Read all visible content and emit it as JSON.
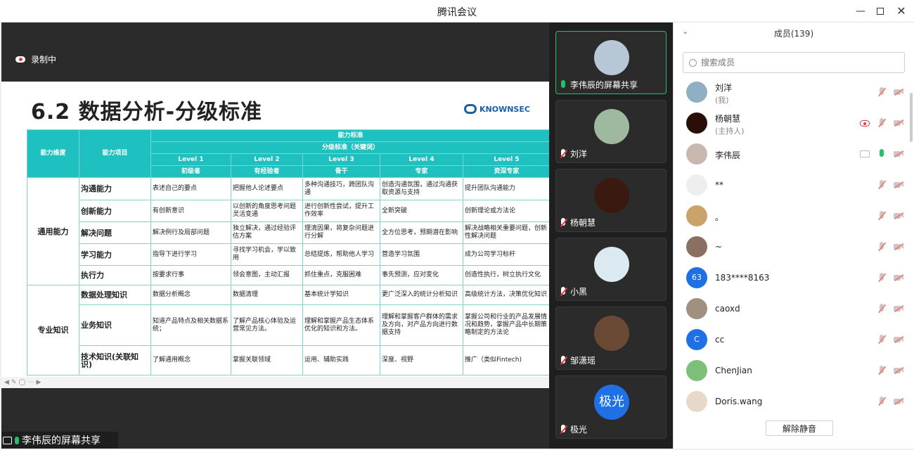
{
  "window": {
    "title": "腾讯会议"
  },
  "recording": {
    "label": "录制中"
  },
  "slide": {
    "title": "6.2 数据分析-分级标准",
    "brand": "KNOWNSEC",
    "header": {
      "dimension": "能力维度",
      "item": "能力项目",
      "standard": "能力标准",
      "grading": "分级标准（关键词）",
      "levels": [
        "Level 1",
        "Level 2",
        "Level 3",
        "Level 4",
        "Level 5"
      ],
      "titles": [
        "初级者",
        "有经验者",
        "骨干",
        "专家",
        "资深专家"
      ]
    },
    "groups": [
      {
        "dimension": "通用能力",
        "rows": [
          {
            "item": "沟通能力",
            "cells": [
              "表述自己的要点",
              "把握他人论述要点",
              "多种沟通技巧，跨团队沟通",
              "创造沟通氛围，通过沟通获取资源与支持",
              "提升团队沟通能力"
            ]
          },
          {
            "item": "创新能力",
            "cells": [
              "有创新意识",
              "以创新的角度思考问题灵活变通",
              "进行创新性尝试，提升工作效率",
              "全新突破",
              "创新理论或方法论"
            ]
          },
          {
            "item": "解决问题",
            "cells": [
              "解决例行及局部问题",
              "独立解决，通过经验评估方案",
              "理清因果，将复杂问题进行分解",
              "全方位思考，预期潜在影响",
              "解决战略相关重要问题，创新性解决问题"
            ]
          },
          {
            "item": "学习能力",
            "cells": [
              "指导下进行学习",
              "寻找学习机会，学以致用",
              "总结提炼，帮助他人学习",
              "营造学习氛围",
              "成为公司学习标杆"
            ]
          },
          {
            "item": "执行力",
            "cells": [
              "按要求行事",
              "领会意图，主动汇报",
              "抓住重点，克服困难",
              "事先预测，应对变化",
              "创造性执行，树立执行文化"
            ]
          }
        ]
      },
      {
        "dimension": "专业知识",
        "rows": [
          {
            "item": "数据处理知识",
            "cells": [
              "数据分析概念",
              "数据清理",
              "基本统计学知识",
              "更广泛深入的统计分析知识",
              "高级统计方法，决策优化知识"
            ]
          },
          {
            "item": "业务知识",
            "cells": [
              "知道产品特点及相关数据系统；",
              "了解产品核心体验及运营常见方法。",
              "理解和掌握产品生态体系优化的知识和方法。",
              "理解和掌握客户群体的需求及方向，对产品方向进行数据支持",
              "掌握公司和行业的产品发展情况和趋势，掌握产品中长期策略制定的方法论"
            ]
          },
          {
            "item": "技术知识(关联知识)",
            "cells": [
              "了解通用概念",
              "掌握关联领域",
              "运用、辅助实践",
              "深度、视野",
              "推广（类似Fintech)"
            ]
          }
        ]
      }
    ]
  },
  "share_label": "李伟辰的屏幕共享",
  "thumbnails": [
    {
      "name": "李伟辰的屏幕共享",
      "active": true,
      "avatar_color": "#b7c7d6"
    },
    {
      "name": "刘洋",
      "active": false,
      "avatar_color": "#9fb8a0"
    },
    {
      "name": "杨朝慧",
      "active": false,
      "avatar_color": "#3a1a10"
    },
    {
      "name": "小黑",
      "active": false,
      "avatar_color": "#dbe9f1"
    },
    {
      "name": "邹潇瑶",
      "active": false,
      "avatar_color": "#6b4a35"
    },
    {
      "name": "极光",
      "active": false,
      "avatar_color": "#1f6fe6",
      "avatar_text": "极光"
    }
  ],
  "panel": {
    "title": "成员(139)",
    "search_placeholder": "搜索成员",
    "unmute_all": "解除静音",
    "members": [
      {
        "name": "刘洋",
        "role": "(我)",
        "avatar_color": "#8fb0c2",
        "avatar_text": ""
      },
      {
        "name": "杨朝慧",
        "role": "(主持人)",
        "avatar_color": "#2a0e08",
        "avatar_text": "",
        "recording": true
      },
      {
        "name": "李伟辰",
        "role": "",
        "avatar_color": "#c9b8b0",
        "avatar_text": "",
        "sharing": true,
        "mic_on": true
      },
      {
        "name": "**",
        "role": "",
        "avatar_color": "#eeeeee",
        "avatar_text": ""
      },
      {
        "name": "。",
        "role": "",
        "avatar_color": "#c9a36a",
        "avatar_text": ""
      },
      {
        "name": "~",
        "role": "",
        "avatar_color": "#8a7060",
        "avatar_text": ""
      },
      {
        "name": "183****8163",
        "role": "",
        "avatar_color": "#1f6fe6",
        "avatar_text": "63"
      },
      {
        "name": "caoxd",
        "role": "",
        "avatar_color": "#a09080",
        "avatar_text": ""
      },
      {
        "name": "cc",
        "role": "",
        "avatar_color": "#1f6fe6",
        "avatar_text": "C"
      },
      {
        "name": "ChenJian",
        "role": "",
        "avatar_color": "#7ec07a",
        "avatar_text": ""
      },
      {
        "name": "Doris.wang",
        "role": "",
        "avatar_color": "#e8d8c8",
        "avatar_text": ""
      }
    ]
  }
}
